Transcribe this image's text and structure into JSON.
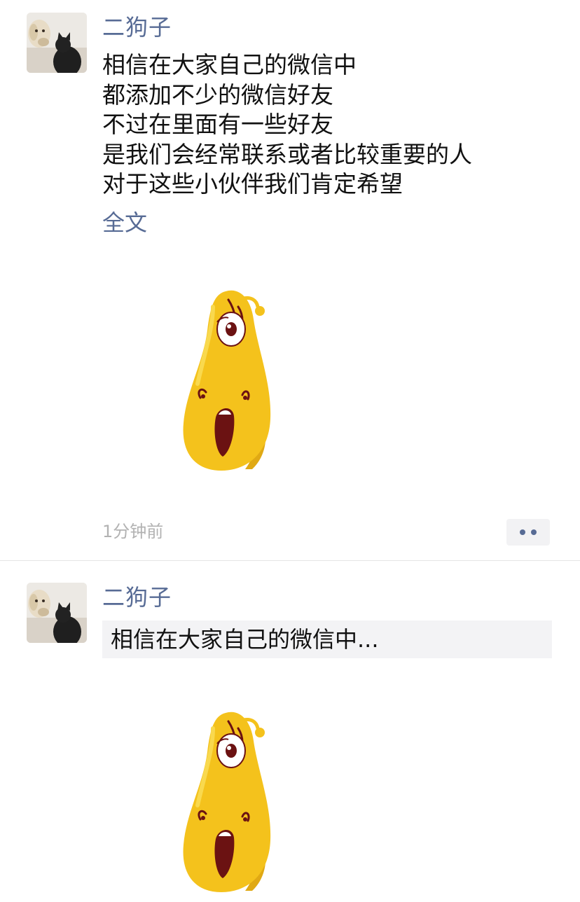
{
  "posts": [
    {
      "nickname": "二狗子",
      "content_lines": [
        "相信在大家自己的微信中",
        "都添加不少的微信好友",
        "不过在里面有一些好友",
        "是我们会经常联系或者比较重要的人",
        "对于这些小伙伴我们肯定希望"
      ],
      "full_text_label": "全文",
      "sticker_icon": "yellow-larva-surprised-sticker",
      "timestamp": "1分钟前",
      "more_icon": "more-dots-icon"
    },
    {
      "nickname": "二狗子",
      "collapsed_text": "相信在大家自己的微信中...",
      "sticker_icon": "yellow-larva-surprised-sticker"
    }
  ],
  "colors": {
    "nickname": "#576b95",
    "text": "#111111",
    "timestamp": "#b2b2b2",
    "sticker_body": "#f4c21c",
    "sticker_mouth": "#6b1212"
  }
}
